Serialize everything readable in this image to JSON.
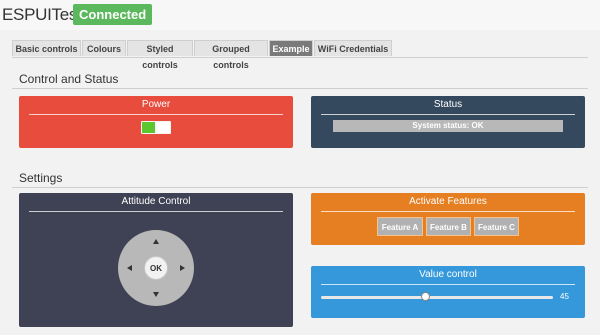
{
  "app": {
    "title": "ESPUITest",
    "connection_status": "Connected"
  },
  "tabs": [
    {
      "label": "Basic controls",
      "active": false
    },
    {
      "label": "Colours",
      "active": false
    },
    {
      "label": "Styled controls",
      "active": false
    },
    {
      "label": "Grouped controls",
      "active": false
    },
    {
      "label": "Example",
      "active": true
    },
    {
      "label": "WiFi Credentials",
      "active": false
    }
  ],
  "sections": {
    "control_status": "Control and Status",
    "settings": "Settings"
  },
  "power": {
    "title": "Power",
    "on": true
  },
  "status": {
    "title": "Status",
    "text": "System status: OK"
  },
  "attitude": {
    "title": "Attitude Control",
    "ok_label": "OK"
  },
  "features": {
    "title": "Activate Features",
    "buttons": [
      "Feature A",
      "Feature B",
      "Feature C"
    ]
  },
  "value_control": {
    "title": "Value control",
    "value": "45",
    "level": 0.45
  },
  "colors": {
    "power": "#e84c3c",
    "status": "#34495e",
    "attitude": "#3f4254",
    "features": "#e67e22",
    "value_control": "#3498db",
    "connected": "#5cb85c"
  }
}
